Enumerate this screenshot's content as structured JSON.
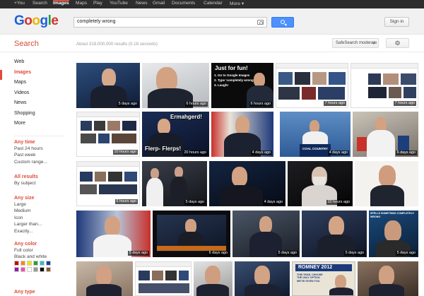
{
  "topbar": {
    "items": [
      "+You",
      "Search",
      "Images",
      "Maps",
      "Play",
      "YouTube",
      "News",
      "Gmail",
      "Documents",
      "Calendar",
      "More ▾"
    ]
  },
  "logo": "Google",
  "search": {
    "query": "completely wrong"
  },
  "signin": "Sign in",
  "section_label": "Search",
  "stats": "About 319,000,000 results (0.18 seconds)",
  "safesearch": "SafeSearch moderate",
  "nav": [
    "Web",
    "Images",
    "Maps",
    "Videos",
    "News",
    "Shopping",
    "More"
  ],
  "any_time": {
    "heading": "Any time",
    "items": [
      "Past 24 hours",
      "Past week",
      "Custom range..."
    ]
  },
  "all_results": {
    "heading": "All results",
    "items": [
      "By subject"
    ]
  },
  "any_size": {
    "heading": "Any size",
    "items": [
      "Large",
      "Medium",
      "Icon",
      "Larger than...",
      "Exactly..."
    ]
  },
  "any_color": {
    "heading": "Any color",
    "items": [
      "Full color",
      "Black and white"
    ]
  },
  "colors": [
    "#cc0000",
    "#f38c12",
    "#f2e200",
    "#2aa12a",
    "#2fbcd6",
    "#1d3e9e",
    "#8b1fa9",
    "#f04fa9",
    "#ffffff",
    "#999999",
    "#000000",
    "#8a5a2b"
  ],
  "any_type": {
    "heading": "Any type"
  },
  "captions": {
    "just_for_fun": "Just for fun!",
    "step1": "1. Go to Google Images",
    "step2": "2. Type 'completely wrong'",
    "step3": "3. Laugh!",
    "ermahgerd": "Ermahgerd!",
    "flerp": "Flerp- Flerps!",
    "coal": "COAL COUNTRY",
    "romney2012": "ROMNEY 2012",
    "spells": "SPELLS SOMETHING COMPLETELY WRONG",
    "this_year": "THIS YEAR, CHOOSE THE ONLY OPTION WE'VE GIVEN YOU"
  },
  "badges": {
    "r1": [
      "5 days ago",
      "6 hours ago",
      "6 hours ago",
      "7 hours ago",
      "7 hours ago"
    ],
    "r2": [
      "10 hours ago",
      "20 hours ago",
      "4 days ago",
      "4 days ago",
      "6 days ago"
    ],
    "r3": [
      "6 hours ago",
      "5 days ago",
      "4 days ago",
      "10 hours ago"
    ],
    "r4": [
      "5 days ago",
      "6 days ago",
      "5 days ago",
      "5 days ago",
      "5 days ago"
    ]
  }
}
